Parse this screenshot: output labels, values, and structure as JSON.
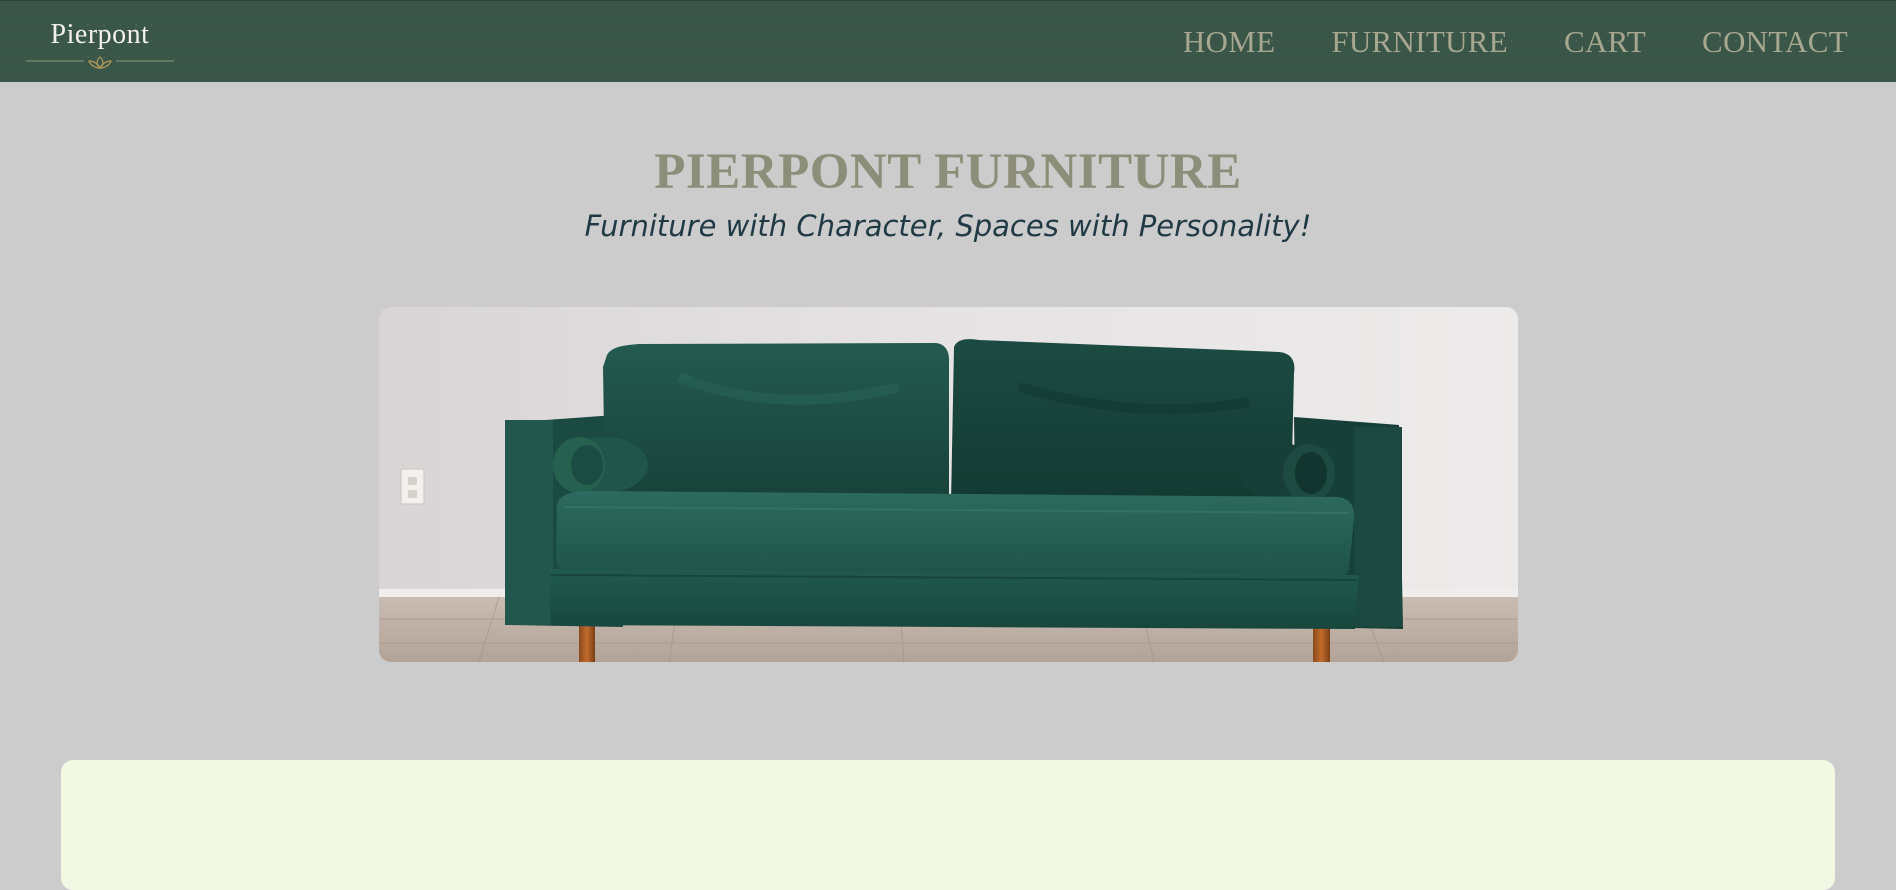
{
  "header": {
    "logo_text": "Pierpont",
    "nav": [
      {
        "label": "HOME"
      },
      {
        "label": "FURNITURE"
      },
      {
        "label": "CART"
      },
      {
        "label": "CONTACT"
      }
    ]
  },
  "hero": {
    "title": "PIERPONT FURNITURE",
    "tagline": "Furniture with Character, Spaces with Personality!"
  },
  "icons": [
    "lotus-ornament-icon",
    "wall-outlet-icon"
  ],
  "colors": {
    "header_bg": "#3a5649",
    "nav_text": "#a7a78f",
    "page_bg": "#cccccc",
    "title": "#8d8e79",
    "tagline": "#1f3a44",
    "card_bg": "#f1f8e3",
    "sofa": "#1f4b42"
  }
}
